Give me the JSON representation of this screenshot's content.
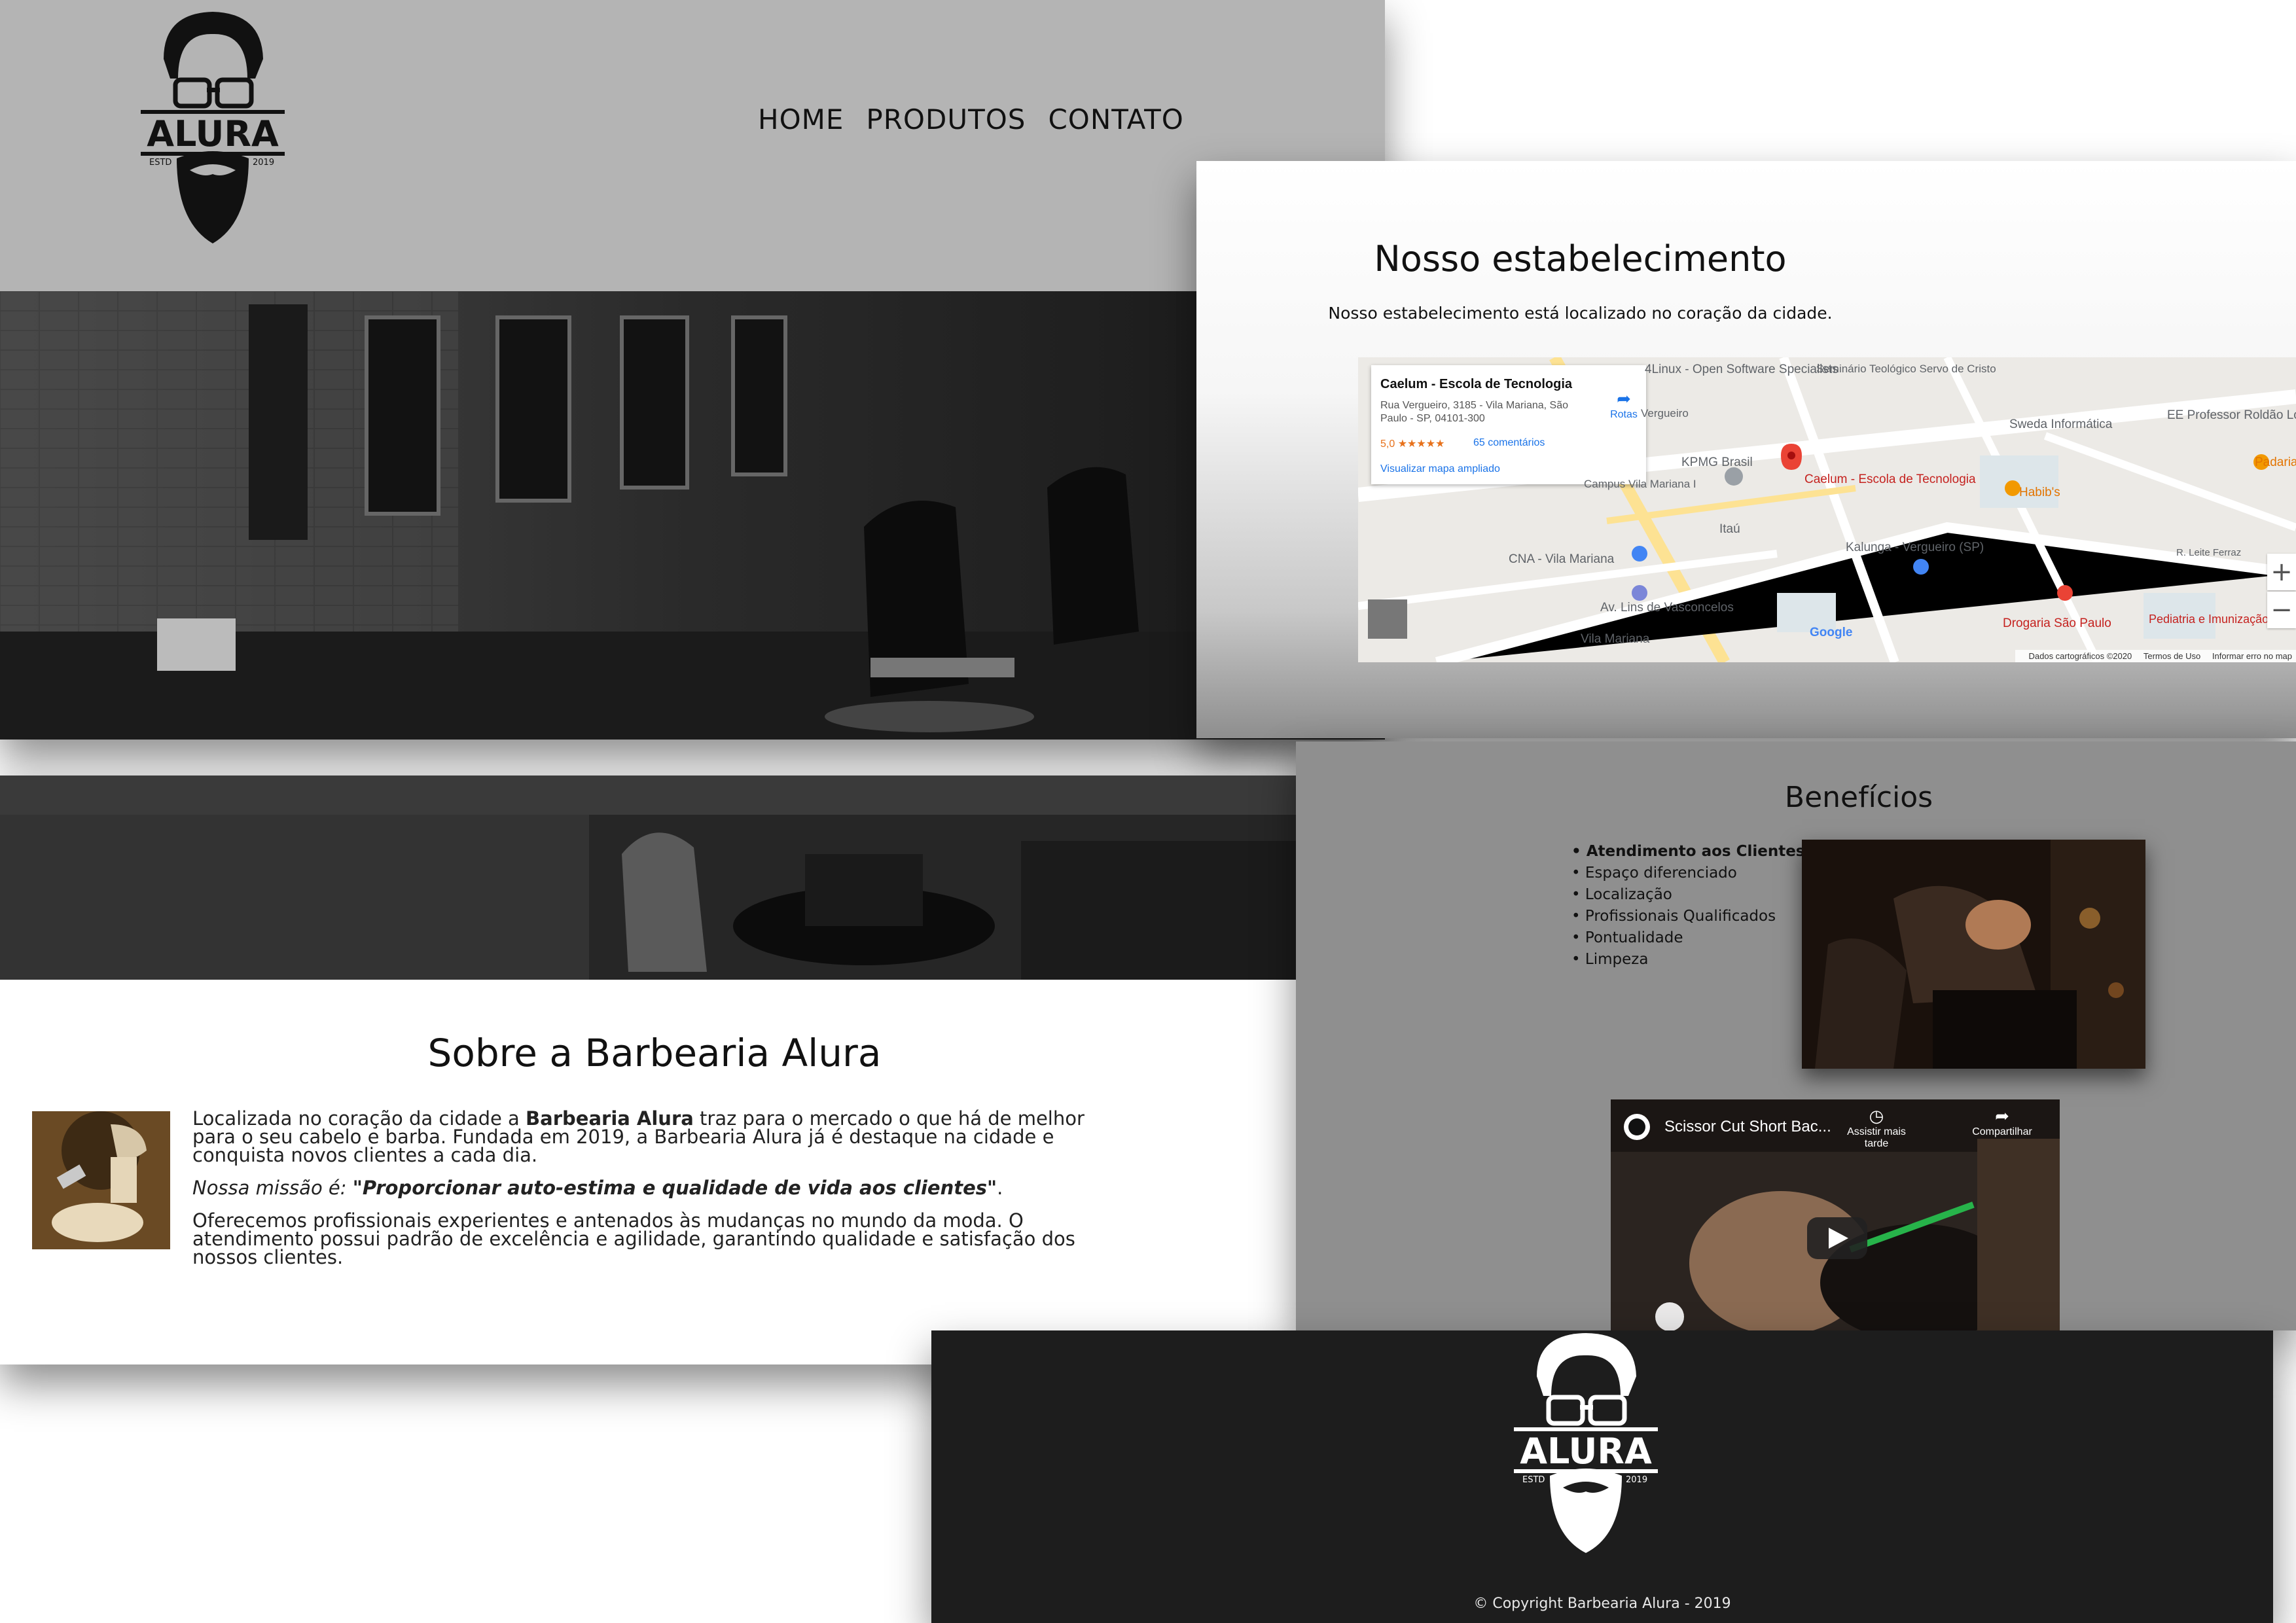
{
  "brand": {
    "logo_text": "ALURA",
    "logo_estd": "ESTD",
    "logo_year": "2019"
  },
  "nav": {
    "items": [
      "HOME",
      "PRODUTOS",
      "CONTATO"
    ]
  },
  "location": {
    "title": "Nosso estabelecimento",
    "lead": "Nosso estabelecimento está localizado no coração da cidade.",
    "map": {
      "place_name": "Caelum - Escola de Tecnologia",
      "address": "Rua Vergueiro, 3185 - Vila Mariana, São Paulo - SP, 04101-300",
      "rating": "5,0 ★★★★★",
      "reviews": "65 comentários",
      "view_larger": "Visualizar mapa ampliado",
      "directions": "Rotas",
      "pin_label": "Caelum - Escola de Tecnologia",
      "labels": [
        "4Linux - Open Software Specialists",
        "Seminário Teológico Servo de Cristo",
        "Sweda Informática",
        "EE Professor Roldão Lopes de Barros",
        "KPMG Brasil",
        "Habib's",
        "Padaria E",
        "Kalunga - Vergueiro (SP)",
        "CNA - Vila Mariana",
        "Itaú",
        "Av. Lins de Vasconcelos",
        "Vila Mariana",
        "Drogaria São Paulo",
        "Pediatria e Imunização - Casa Crescer",
        "R. Leite Ferraz",
        "Vergueiro",
        "Campus Vila Mariana I",
        "Google"
      ],
      "zoom_in": "+",
      "zoom_out": "−",
      "footer": [
        "Dados cartográficos ©2020",
        "Termos de Uso",
        "Informar erro no map"
      ]
    }
  },
  "about": {
    "title": "Sobre a Barbearia Alura",
    "p1_before": "Localizada no coração da cidade a ",
    "p1_bold": "Barbearia Alura",
    "p1_after": " traz para o mercado o que há de melhor para o seu cabelo e barba. Fundada em 2019, a Barbearia Alura já é destaque na cidade e conquista novos clientes a cada dia.",
    "mission_label": "Nossa missão é: ",
    "mission_quote": "\"Proporcionar auto-estima e qualidade de vida aos clientes\"",
    "p3": "Oferecemos profissionais experientes e antenados às mudanças no mundo da moda. O atendimento possui padrão de excelência e agilidade, garantindo qualidade e satisfação dos nossos clientes."
  },
  "benefits": {
    "title": "Benefícios",
    "items": [
      "Atendimento aos Clientes",
      "Espaço diferenciado",
      "Localização",
      "Profissionais Qualificados",
      "Pontualidade",
      "Limpeza"
    ],
    "video": {
      "title": "Scissor Cut Short Bac...",
      "watch_later": "Assistir mais tarde",
      "share": "Compartilhar"
    }
  },
  "footer": {
    "copyright": "© Copyright Barbearia Alura - 2019"
  }
}
